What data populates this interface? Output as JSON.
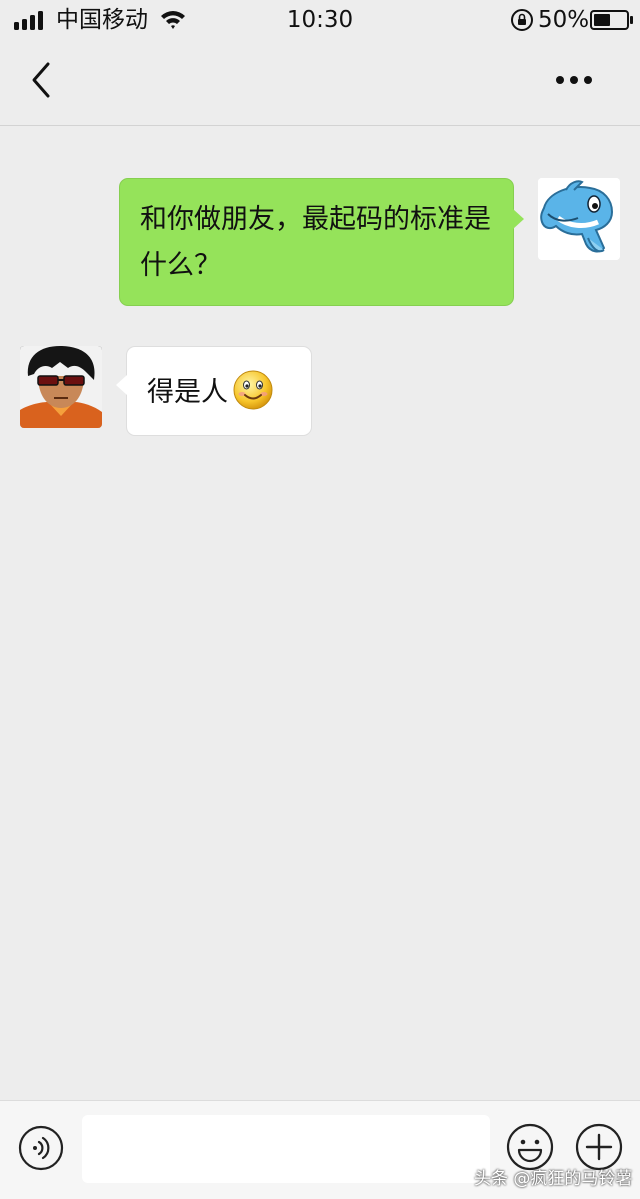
{
  "status_bar": {
    "carrier": "中国移动",
    "time": "10:30",
    "battery_percent": "50%",
    "battery_level": 0.5,
    "icons": [
      "signal-icon",
      "wifi-icon",
      "orientation-lock-icon",
      "battery-icon"
    ]
  },
  "nav": {
    "icons": [
      "back-chevron-icon",
      "more-dots-icon"
    ]
  },
  "messages": [
    {
      "side": "right",
      "avatar": "dolphin-avatar",
      "text": "和你做朋友，最起码的标准是什么？"
    },
    {
      "side": "left",
      "avatar": "man-sunglasses-avatar",
      "text": "得是人",
      "emoji": "smile-emoji"
    }
  ],
  "input_bar": {
    "input_value": "",
    "icons": [
      "voice-icon",
      "emoji-icon",
      "plus-icon"
    ]
  },
  "watermark": "头条 @疯狂的马铃薯",
  "colors": {
    "background": "#ededed",
    "sent_bubble": "#95e35a",
    "received_bubble": "#ffffff"
  }
}
